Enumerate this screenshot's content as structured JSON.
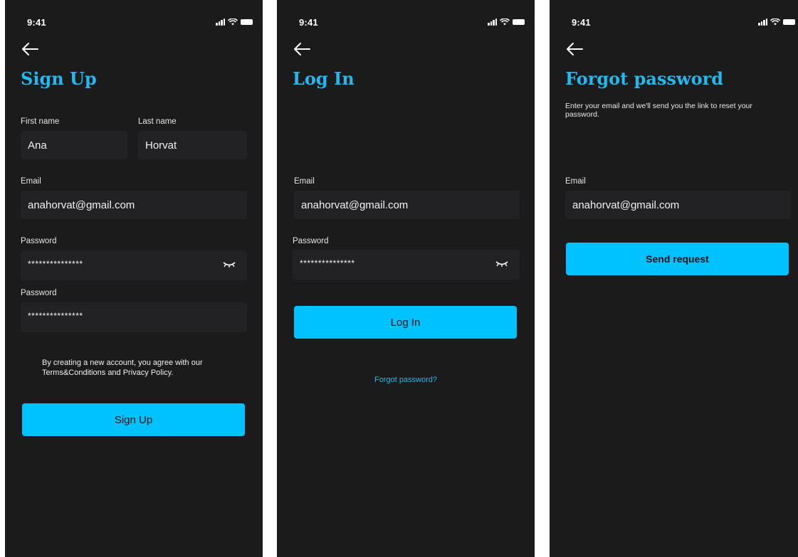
{
  "status": {
    "time": "9:41"
  },
  "signup": {
    "title": "Sign Up",
    "first_name_label": "First name",
    "first_name_value": "Ana",
    "last_name_label": "Last name",
    "last_name_value": "Horvat",
    "email_label": "Email",
    "email_value": "anahorvat@gmail.com",
    "password_label": "Password",
    "password_value": "***************",
    "confirm_label": "Password",
    "confirm_value": "***************",
    "terms_line1": "By creating a new account, you agree with our",
    "terms_line2": "Terms&Conditions and Privacy Policy.",
    "button": "Sign Up"
  },
  "login": {
    "title": "Log In",
    "email_label": "Email",
    "email_value": "anahorvat@gmail.com",
    "password_label": "Password",
    "password_value": "***************",
    "button": "Log In",
    "forgot_link": "Forgot password?"
  },
  "forgot": {
    "title": "Forgot password",
    "subtitle": "Enter your email and we'll send you the link to reset your password.",
    "email_label": "Email",
    "email_value": "anahorvat@gmail.com",
    "button": "Send request"
  },
  "colors": {
    "accent": "#00c2ff",
    "title": "#22b8f0",
    "background": "#1b1b1c",
    "field": "#222224"
  }
}
